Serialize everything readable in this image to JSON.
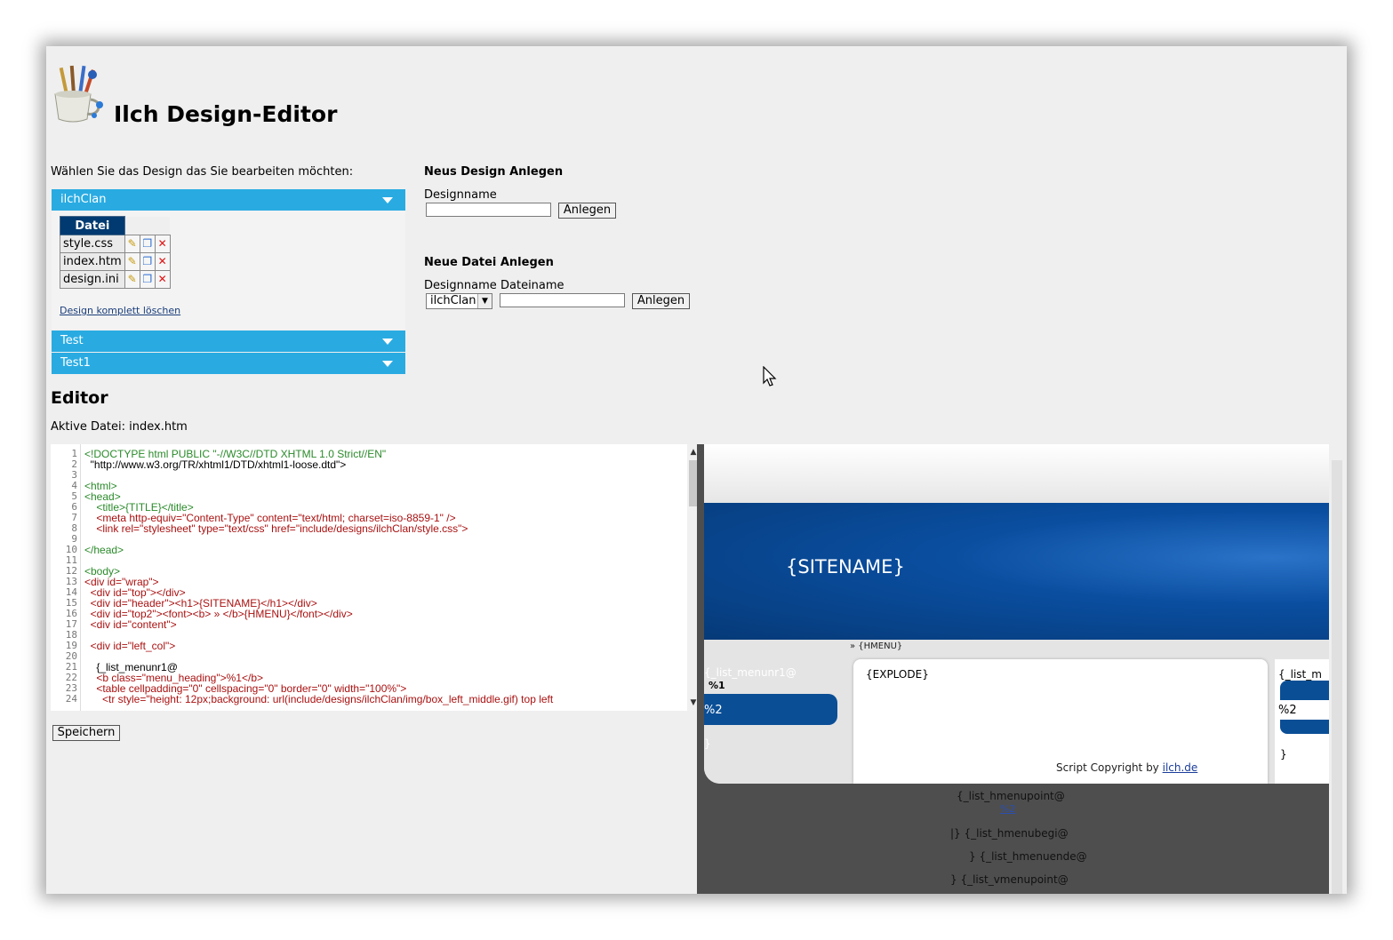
{
  "app": {
    "title": "Ilch Design-Editor",
    "logo_icon": "paint-brushes-cup-icon"
  },
  "designs": {
    "choose_label": "Wählen Sie das Design das Sie bearbeiten möchten:",
    "accordion": [
      {
        "name": "ilchClan",
        "expanded": true
      },
      {
        "name": "Test",
        "expanded": false
      },
      {
        "name": "Test1",
        "expanded": false
      }
    ],
    "files_header": "Datei",
    "files": [
      "style.css",
      "index.htm",
      "design.ini"
    ],
    "delete_design_link": "Design komplett löschen"
  },
  "new_design": {
    "title": "Neus Design Anlegen",
    "name_label": "Designname",
    "name_value": "",
    "button": "Anlegen"
  },
  "new_file": {
    "title": "Neue Datei Anlegen",
    "design_label": "Designname",
    "file_label": "Dateiname",
    "design_selected": "ilchClan",
    "file_value": "",
    "button": "Anlegen"
  },
  "editor": {
    "title": "Editor",
    "active_file": "Aktive Datei: index.htm",
    "save_button": "Speichern",
    "line_numbers": [
      "1",
      "2",
      "3",
      "4",
      "5",
      "6",
      "7",
      "8",
      "9",
      "10",
      "11",
      "12",
      "13",
      "14",
      "15",
      "16",
      "17",
      "18",
      "19",
      "20",
      "21",
      "22",
      "23",
      "24"
    ],
    "lines": [
      "<!DOCTYPE html PUBLIC \"-//W3C//DTD XHTML 1.0 Strict//EN\"",
      "  \"http://www.w3.org/TR/xhtml1/DTD/xhtml1-loose.dtd\">",
      "",
      "<html>",
      "<head>",
      "    <title>{TITLE}</title>",
      "    <meta http-equiv=\"Content-Type\" content=\"text/html; charset=iso-8859-1\" />",
      "    <link rel=\"stylesheet\" type=\"text/css\" href=\"include/designs/ilchClan/style.css\">",
      "",
      "</head>",
      "",
      "<body>",
      "<div id=\"wrap\">",
      "  <div id=\"top\"></div>",
      "  <div id=\"header\"><h1>{SITENAME}</h1></div>",
      "  <div id=\"top2\"><font><b> » </b>{HMENU}</font></div>",
      "  <div id=\"content\">",
      "",
      "  <div id=\"left_col\">",
      "",
      "    {_list_menunr1@",
      "    <b class=\"menu_heading\">%1</b>",
      "    <table cellpadding=\"0\" cellspacing=\"0\" border=\"0\" width=\"100%\">",
      "      <tr style=\"height: 12px;background: url(include/designs/ilchClan/img/box_left_middle.gif) top left"
    ]
  },
  "preview": {
    "sitename": "{SITENAME}",
    "hmenu": "» {HMENU}",
    "left_menu_text": "{_list_menunr1@",
    "left_menu_bold": "%1",
    "left_menu_item": "%2",
    "left_brace": "}",
    "explode": "{EXPLODE}",
    "right_menu_text": "{_list_m",
    "right_menu_item": "%2",
    "right_brace": "}",
    "copyright_prefix": "Script Copyright by ",
    "copyright_link": "ilch.de",
    "dark_lines": [
      "{_list_hmenupoint@",
      "|} {_list_hmenubegi@",
      "} {_list_hmenuende@",
      "} {_list_vmenupoint@"
    ],
    "dark_link": "%2"
  }
}
